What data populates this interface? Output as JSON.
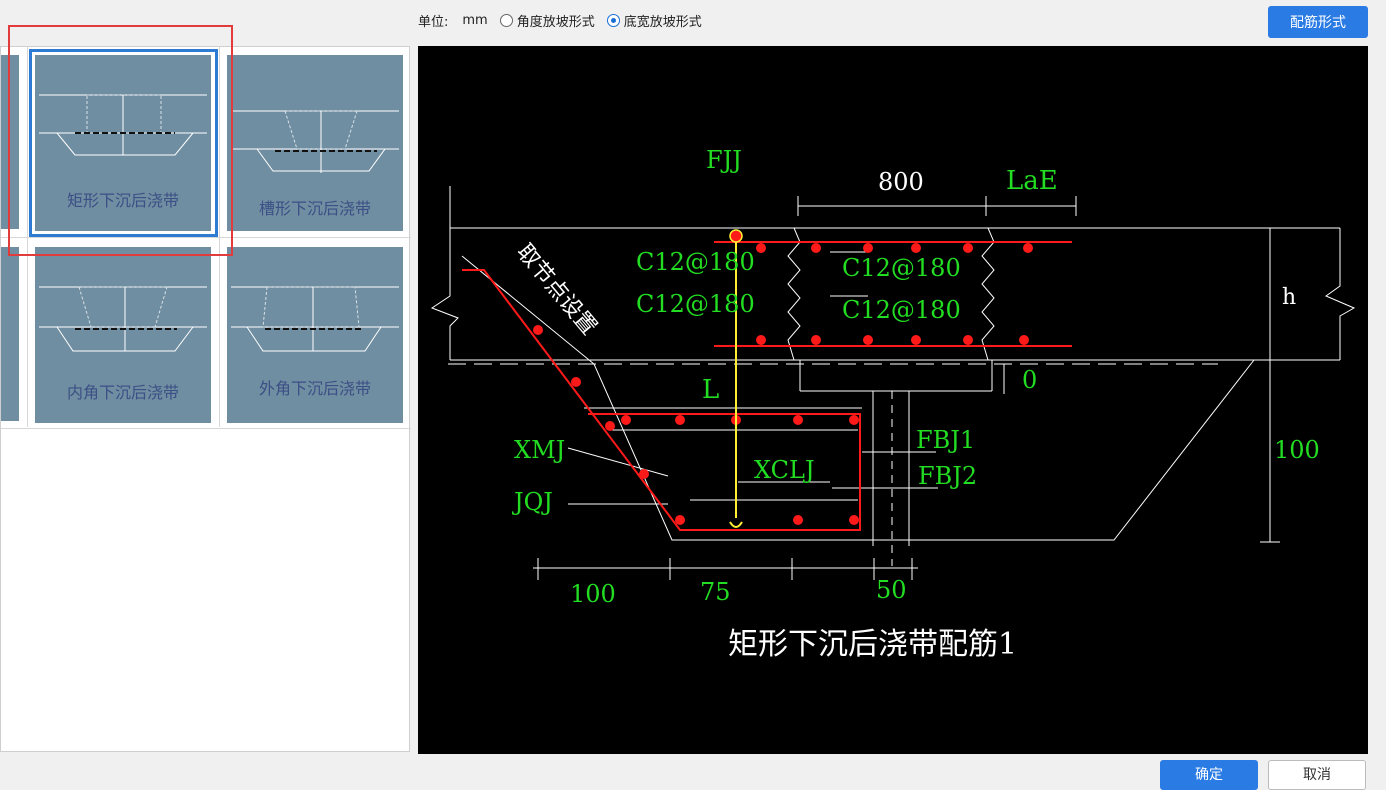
{
  "toolbar": {
    "unit_label": "单位:",
    "unit_value": "mm",
    "radio_angle": "角度放坡形式",
    "radio_width": "底宽放坡形式",
    "selected": "radio_width",
    "rebar_button": "配筋形式"
  },
  "thumbnails": [
    {
      "label": "矩形下沉后浇带",
      "selected": true
    },
    {
      "label": "槽形下沉后浇带",
      "selected": false
    },
    {
      "label": "内角下沉后浇带",
      "selected": false
    },
    {
      "label": "外角下沉后浇带",
      "selected": false
    }
  ],
  "drawing": {
    "title": "矩形下沉后浇带配筋1",
    "labels": {
      "fjj": "FJJ",
      "dim_800": "800",
      "lae": "LaE",
      "c12_1": "C12@180",
      "c12_2": "C12@180",
      "c12_3": "C12@180",
      "c12_4": "C12@180",
      "node": "取节点设置",
      "h": "h",
      "zero": "0",
      "L": "L",
      "fbj1": "FBJ1",
      "fbj2": "FBJ2",
      "xmj": "XMJ",
      "xclj": "XCLJ",
      "jqj": "JQJ",
      "dim_100_right": "100",
      "dim_100_bottom": "100",
      "dim_75": "75",
      "dim_50": "50"
    }
  },
  "footer": {
    "ok": "确定",
    "cancel": "取消"
  },
  "colors": {
    "accent": "#2a7be4",
    "thumb_bg": "#6f8ea1",
    "cad_bg": "#000000",
    "cad_green": "#22dd22",
    "cad_red": "#ff1a1a",
    "cad_yellow": "#ffee33"
  }
}
